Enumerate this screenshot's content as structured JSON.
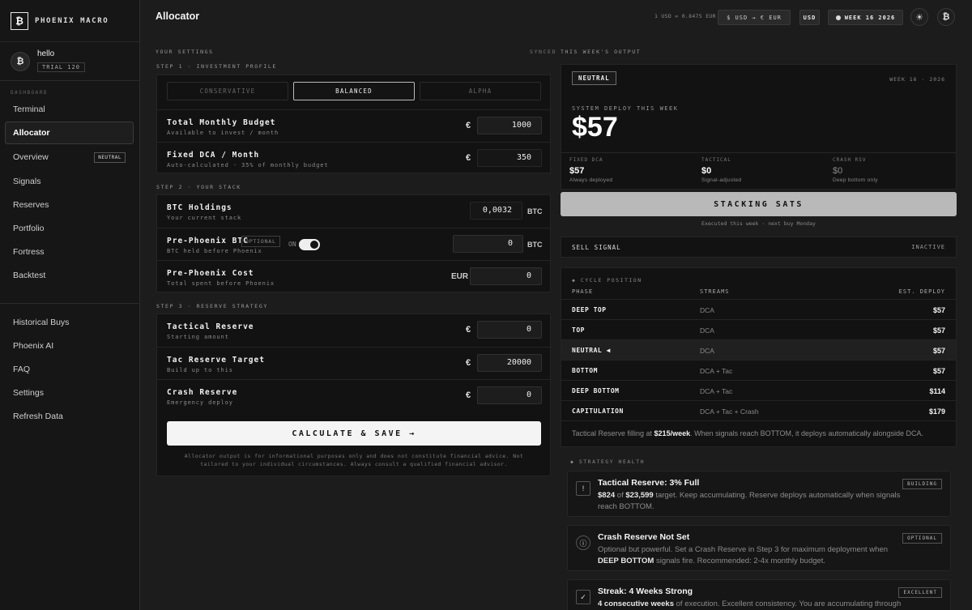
{
  "brand": {
    "logo": "₿",
    "name": "PHOENIX MACRO"
  },
  "user": {
    "avatar": "₿",
    "name": "hello",
    "badge": "TRIAL 120"
  },
  "nav": {
    "section": "DASHBOARD",
    "items": [
      {
        "label": "Terminal"
      },
      {
        "label": "Allocator",
        "active": true
      },
      {
        "label": "Overview",
        "badge": "NEUTRAL"
      },
      {
        "label": "Signals"
      },
      {
        "label": "Reserves"
      },
      {
        "label": "Portfolio"
      },
      {
        "label": "Fortress"
      },
      {
        "label": "Backtest"
      }
    ],
    "bottom_items": [
      {
        "label": "Historical Buys"
      },
      {
        "label": "Phoenix AI"
      },
      {
        "label": "FAQ"
      },
      {
        "label": "Settings"
      },
      {
        "label": "Refresh Data"
      }
    ]
  },
  "topbar": {
    "title": "Allocator",
    "rate": "1 USD = 0.8475 EUR",
    "convert": "$ USD → € EUR",
    "currency": "USD",
    "week": "WEEK 16 2026",
    "theme_icon": "☀",
    "avatar": "₿"
  },
  "settings": {
    "header": "YOUR SETTINGS",
    "status": "SYNCED",
    "step1": "STEP 1 · INVESTMENT PROFILE",
    "profiles": [
      "CONSERVATIVE",
      "BALANCED",
      "ALPHA"
    ],
    "budget": {
      "label": "Total Monthly Budget",
      "sub": "Available to invest / month",
      "currency": "€",
      "value": "1000"
    },
    "fixed_dca": {
      "label": "Fixed DCA / Month",
      "sub": "Auto-calculated · 35% of monthly budget",
      "currency": "€",
      "value": "350"
    },
    "step2": "STEP 2 · YOUR STACK",
    "holdings": {
      "label": "BTC Holdings",
      "sub": "Your current stack",
      "value": "0,0032",
      "unit": "BTC"
    },
    "pre_btc": {
      "label": "Pre-Phoenix BTC",
      "optional": "OPTIONAL",
      "sub": "BTC held before Phoenix",
      "toggle": "ON",
      "value": "0",
      "unit": "BTC"
    },
    "pre_cost": {
      "label": "Pre-Phoenix Cost",
      "sub": "Total spent before Phoenix",
      "unit": "EUR",
      "value": "0"
    },
    "step3": "STEP 3 · RESERVE STRATEGY",
    "tactical": {
      "label": "Tactical Reserve",
      "sub": "Starting amount",
      "currency": "€",
      "value": "0"
    },
    "tac_target": {
      "label": "Tac Reserve Target",
      "sub": "Build up to this",
      "currency": "€",
      "value": "20000"
    },
    "crash": {
      "label": "Crash Reserve",
      "sub": "Emergency deploy",
      "currency": "€",
      "value": "0"
    },
    "calc_button": "CALCULATE & SAVE →",
    "disclaimer": "Allocator output is for informational purposes only and does not constitute financial advice. Not tailored to your individual circumstances. Always consult a qualified financial advisor."
  },
  "output": {
    "header": "THIS WEEK'S OUTPUT",
    "signal": "NEUTRAL",
    "week": "WEEK 16 · 2026",
    "deploy_label": "SYSTEM DEPLOY THIS WEEK",
    "deploy_value": "$57",
    "breakdown": [
      {
        "label": "FIXED DCA",
        "value": "$57",
        "sub": "Always deployed"
      },
      {
        "label": "TACTICAL",
        "value": "$0",
        "sub": "Signal-adjusted"
      },
      {
        "label": "CRASH RSV",
        "value": "$0",
        "sub": "Deep bottom only"
      }
    ],
    "stack_button": "STACKING SATS",
    "exec_note": "Executed this week · next buy Monday",
    "sell_label": "SELL SIGNAL",
    "sell_status": "INACTIVE"
  },
  "cycle": {
    "title": "◆ CYCLE POSITION",
    "headers": [
      "PHASE",
      "STREAMS",
      "EST. DEPLOY"
    ],
    "rows": [
      {
        "phase": "DEEP TOP",
        "streams": "DCA",
        "deploy": "$57"
      },
      {
        "phase": "TOP",
        "streams": "DCA",
        "deploy": "$57"
      },
      {
        "phase": "NEUTRAL ◀",
        "streams": "DCA",
        "deploy": "$57",
        "current": true
      },
      {
        "phase": "BOTTOM",
        "streams": "DCA + Tac",
        "deploy": "$57"
      },
      {
        "phase": "DEEP BOTTOM",
        "streams": "DCA + Tac",
        "deploy": "$114"
      },
      {
        "phase": "CAPITULATION",
        "streams": "DCA + Tac + Crash",
        "deploy": "$179"
      }
    ],
    "note_pre": "Tactical Reserve filling at ",
    "note_amount": "$215/week",
    "note_post": ". When signals reach BOTTOM, it deploys automatically alongside DCA."
  },
  "health": {
    "title": "◆ STRATEGY HEALTH",
    "cards": [
      {
        "icon": "!",
        "title": "Tactical Reserve: 3% Full",
        "badge": "BUILDING",
        "b1": "$824",
        "t1": " of ",
        "b2": "$23,599",
        "t2": " target. Keep accumulating. Reserve deploys automatically when signals reach BOTTOM."
      },
      {
        "icon": "ⓘ",
        "title": "Crash Reserve Not Set",
        "badge": "OPTIONAL",
        "t0": "Optional but powerful. Set a Crash Reserve in Step 3 for maximum deployment when ",
        "b1": "DEEP BOTTOM",
        "t1": " signals fire. Recommended: 2-4x monthly budget."
      },
      {
        "icon": "✓",
        "title": "Streak: 4 Weeks Strong",
        "badge": "EXCELLENT",
        "b1": "4 consecutive weeks",
        "t1": " of execution. Excellent consistency. You are accumulating through"
      }
    ]
  }
}
